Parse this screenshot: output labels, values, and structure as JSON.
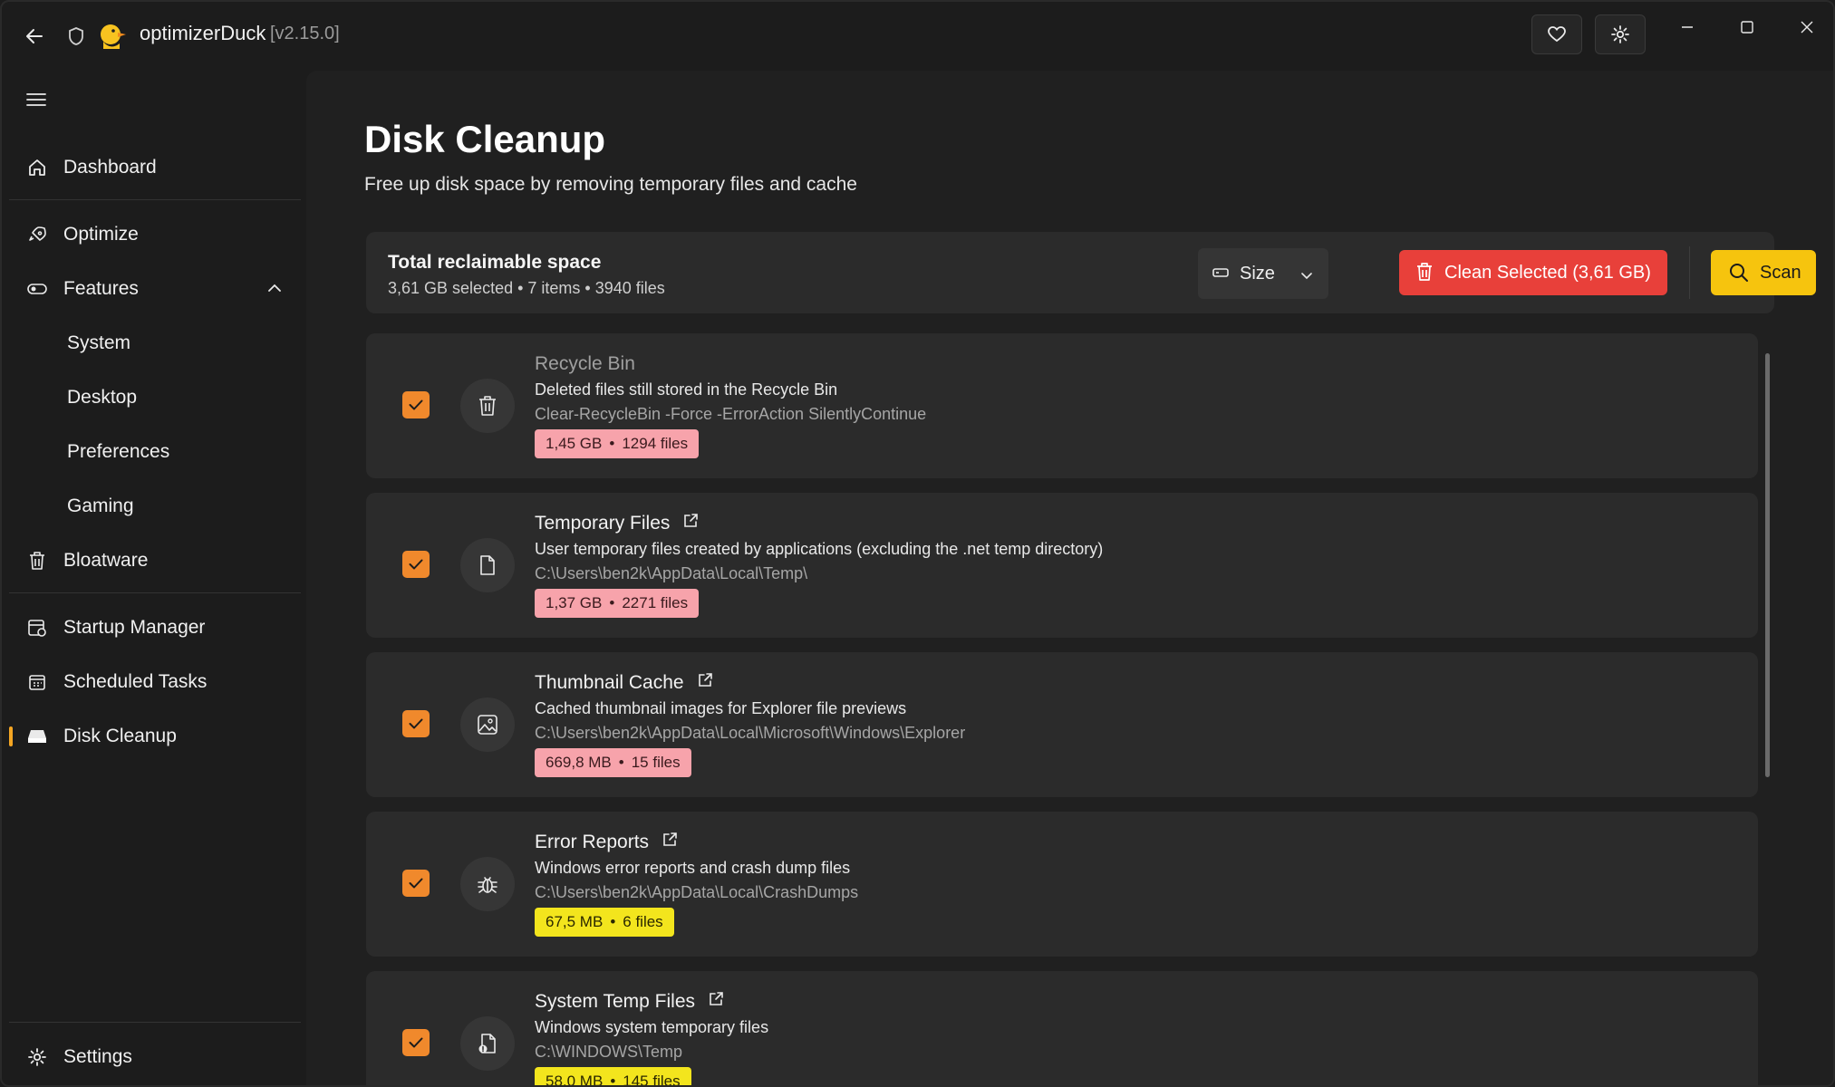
{
  "titlebar": {
    "app_name": "optimizerDuck",
    "version": "[v2.15.0]"
  },
  "sidebar": {
    "items": [
      {
        "label": "Dashboard"
      },
      {
        "label": "Optimize"
      },
      {
        "label": "Features"
      },
      {
        "label": "System"
      },
      {
        "label": "Desktop"
      },
      {
        "label": "Preferences"
      },
      {
        "label": "Gaming"
      },
      {
        "label": "Bloatware"
      },
      {
        "label": "Startup Manager"
      },
      {
        "label": "Scheduled Tasks"
      },
      {
        "label": "Disk Cleanup"
      }
    ],
    "settings_label": "Settings",
    "active": "Disk Cleanup"
  },
  "page": {
    "title": "Disk Cleanup",
    "subtitle": "Free up disk space by removing temporary files and cache"
  },
  "summary": {
    "title": "Total reclaimable space",
    "meta": "3,61 GB selected • 7 items • 3940 files",
    "sort_value": "Size",
    "clean_label": "Clean Selected (3,61 GB)",
    "scan_label": "Scan"
  },
  "items": [
    {
      "name": "Recycle Bin",
      "desc": "Deleted files still stored in the Recycle Bin",
      "cmd": "Clear-RecycleBin -Force -ErrorAction SilentlyContinue",
      "size": "1,45 GB",
      "files": "1294 files",
      "checked": true
    },
    {
      "name": "Temporary Files",
      "desc": "User temporary files created by applications (excluding the .net temp directory)",
      "cmd": "C:\\Users\\ben2k\\AppData\\Local\\Temp\\",
      "size": "1,37 GB",
      "files": "2271 files",
      "checked": true
    },
    {
      "name": "Thumbnail Cache",
      "desc": "Cached thumbnail images for Explorer file previews",
      "cmd": "C:\\Users\\ben2k\\AppData\\Local\\Microsoft\\Windows\\Explorer",
      "size": "669,8 MB",
      "files": "15 files",
      "checked": true
    },
    {
      "name": "Error Reports",
      "desc": "Windows error reports and crash dump files",
      "cmd": "C:\\Users\\ben2k\\AppData\\Local\\CrashDumps",
      "size": "67,5 MB",
      "files": "6 files",
      "checked": true
    },
    {
      "name": "System Temp Files",
      "desc": "Windows system temporary files",
      "cmd": "C:\\WINDOWS\\Temp",
      "size": "58,0 MB",
      "files": "145 files",
      "checked": true
    }
  ],
  "badge_separator": "•",
  "colors": {
    "accent": "#f5a623",
    "checkbox": "#f0892c",
    "danger": "#e8403a",
    "scan": "#f6c40e",
    "badge_large": "#f7a3ab",
    "badge_small": "#f3e51d"
  },
  "icons": {
    "back": "arrow-left-icon",
    "shield": "shield-icon",
    "logo": "duck-logo-icon",
    "heart": "heart-icon",
    "settings_gear": "gear-icon"
  }
}
